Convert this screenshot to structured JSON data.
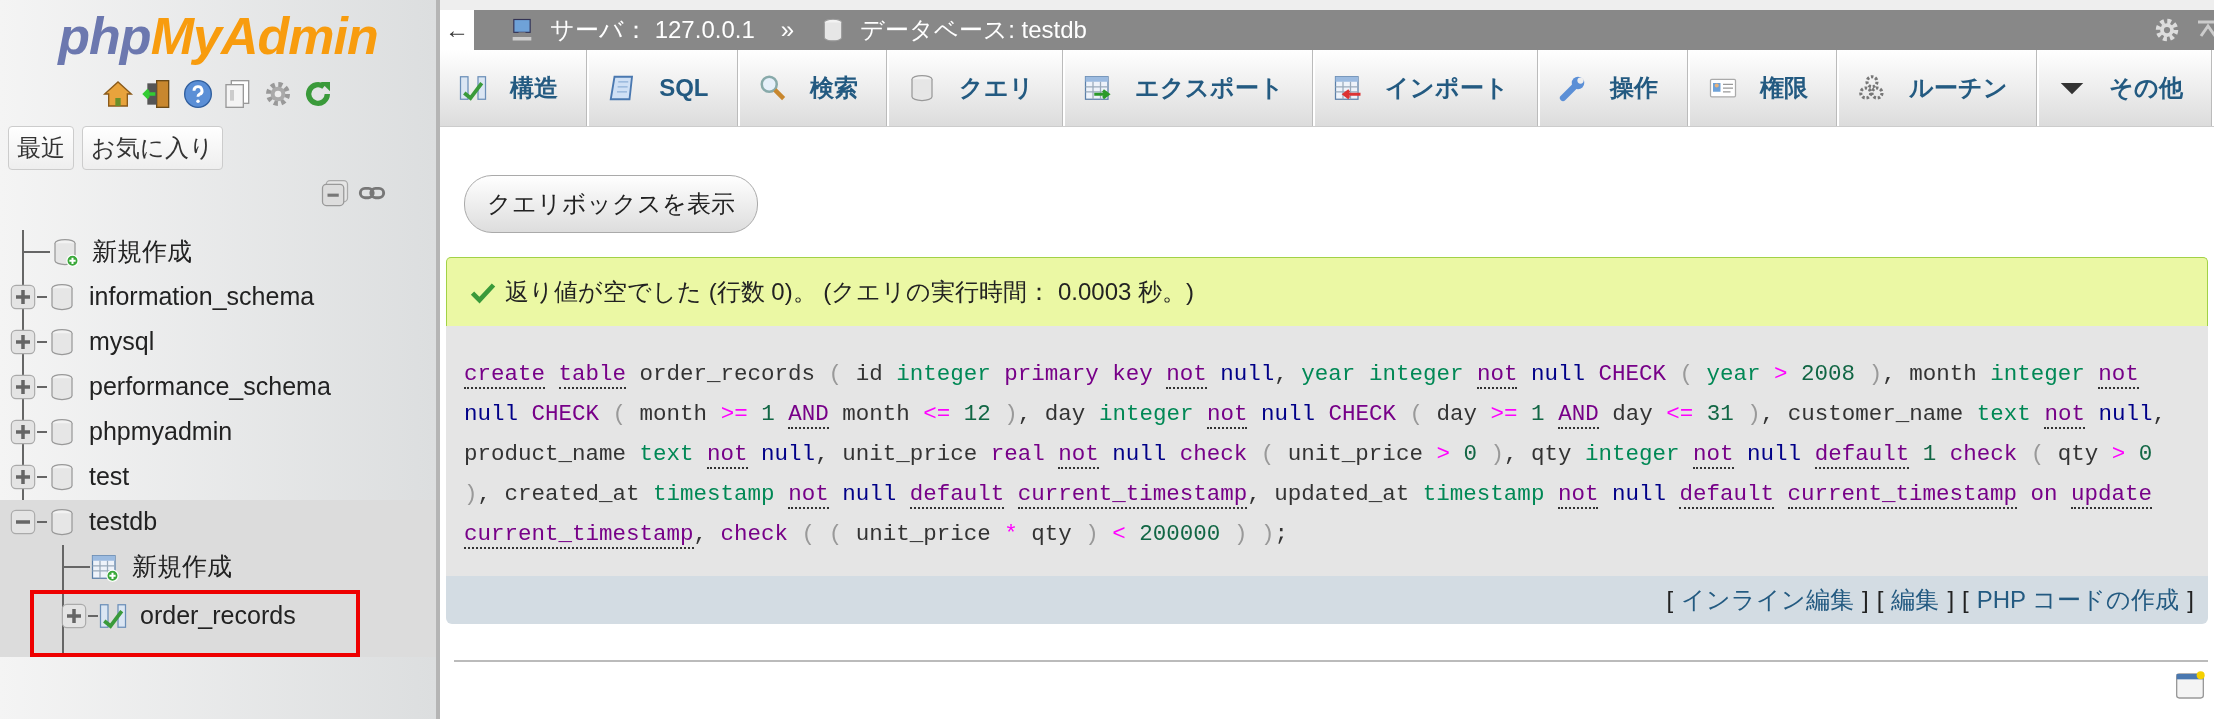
{
  "sidebar": {
    "logo": [
      {
        "text": "php",
        "color": "#6c78af"
      },
      {
        "text": "MyAdmin",
        "color": "#f89c0e"
      }
    ],
    "buttons": [
      "最近",
      "お気に入り"
    ],
    "tree": [
      {
        "label": "新規作成",
        "kind": "new",
        "selected": false
      },
      {
        "label": "information_schema",
        "kind": "database",
        "expanded": false,
        "selected": false
      },
      {
        "label": "mysql",
        "kind": "database",
        "expanded": false,
        "selected": false
      },
      {
        "label": "performance_schema",
        "kind": "database",
        "expanded": false,
        "selected": false
      },
      {
        "label": "phpmyadmin",
        "kind": "database",
        "expanded": false,
        "selected": false
      },
      {
        "label": "test",
        "kind": "database",
        "expanded": false,
        "selected": false
      },
      {
        "label": "testdb",
        "kind": "database",
        "expanded": true,
        "selected": true,
        "children": [
          {
            "label": "新規作成",
            "kind": "new-table",
            "selected": false
          },
          {
            "label": "order_records",
            "kind": "table",
            "expanded": false,
            "selected": false,
            "annotated": true
          }
        ]
      }
    ]
  },
  "breadcrumb": {
    "back": "←",
    "server": "サーバ： 127.0.0.1",
    "separator": "»",
    "database": "データベース: testdb"
  },
  "tabs": [
    {
      "label": "構造",
      "selected": false
    },
    {
      "label": "SQL",
      "selected": false
    },
    {
      "label": "検索",
      "selected": false
    },
    {
      "label": "クエリ",
      "selected": false
    },
    {
      "label": "エクスポート",
      "selected": false
    },
    {
      "label": "インポート",
      "selected": false
    },
    {
      "label": "操作",
      "selected": false
    },
    {
      "label": "権限",
      "selected": false
    },
    {
      "label": "ルーチン",
      "selected": false
    },
    {
      "label": "その他",
      "selected": false
    }
  ],
  "query_box_button": "クエリボックスを表示",
  "message": "返り値が空でした (行数 0)。 (クエリの実行時間： 0.0003 秒。)",
  "sql_tokens": [
    {
      "text": "create",
      "kind": "doc"
    },
    {
      "text": "table",
      "kind": "doc"
    },
    {
      "text": "order_records",
      "kind": "ident"
    },
    {
      "text": "(",
      "kind": "paren"
    },
    {
      "text": "id",
      "kind": "ident"
    },
    {
      "text": "integer",
      "kind": "type"
    },
    {
      "text": "primary",
      "kind": "keyword"
    },
    {
      "text": "key",
      "kind": "keyword"
    },
    {
      "text": "not",
      "kind": "doc"
    },
    {
      "text": "null",
      "kind": "null"
    },
    {
      "text": ",",
      "kind": "punct"
    },
    {
      "text": "year",
      "kind": "type"
    },
    {
      "text": "integer",
      "kind": "type"
    },
    {
      "text": "not",
      "kind": "doc"
    },
    {
      "text": "null",
      "kind": "null"
    },
    {
      "text": "CHECK",
      "kind": "keyword"
    },
    {
      "text": "(",
      "kind": "paren"
    },
    {
      "text": "year",
      "kind": "type"
    },
    {
      "text": ">",
      "kind": "operator"
    },
    {
      "text": "2008",
      "kind": "number"
    },
    {
      "text": ")",
      "kind": "paren"
    },
    {
      "text": ",",
      "kind": "punct"
    },
    {
      "text": "month",
      "kind": "ident"
    },
    {
      "text": "integer",
      "kind": "type"
    },
    {
      "text": "not",
      "kind": "doc"
    },
    {
      "text": "null",
      "kind": "null"
    },
    {
      "text": "CHECK",
      "kind": "keyword"
    },
    {
      "text": "(",
      "kind": "paren"
    },
    {
      "text": "month",
      "kind": "ident"
    },
    {
      "text": ">=",
      "kind": "operator"
    },
    {
      "text": "1",
      "kind": "number"
    },
    {
      "text": "AND",
      "kind": "doc"
    },
    {
      "text": "month",
      "kind": "ident"
    },
    {
      "text": "<=",
      "kind": "operator"
    },
    {
      "text": "12",
      "kind": "number"
    },
    {
      "text": ")",
      "kind": "paren"
    },
    {
      "text": ",",
      "kind": "punct"
    },
    {
      "text": "day",
      "kind": "ident"
    },
    {
      "text": "integer",
      "kind": "type"
    },
    {
      "text": "not",
      "kind": "doc"
    },
    {
      "text": "null",
      "kind": "null"
    },
    {
      "text": "CHECK",
      "kind": "keyword"
    },
    {
      "text": "(",
      "kind": "paren"
    },
    {
      "text": "day",
      "kind": "ident"
    },
    {
      "text": ">=",
      "kind": "operator"
    },
    {
      "text": "1",
      "kind": "number"
    },
    {
      "text": "AND",
      "kind": "doc"
    },
    {
      "text": "day",
      "kind": "ident"
    },
    {
      "text": "<=",
      "kind": "operator"
    },
    {
      "text": "31",
      "kind": "number"
    },
    {
      "text": ")",
      "kind": "paren"
    },
    {
      "text": ",",
      "kind": "punct"
    },
    {
      "text": "customer_name",
      "kind": "ident"
    },
    {
      "text": "text",
      "kind": "type"
    },
    {
      "text": "not",
      "kind": "doc"
    },
    {
      "text": "null",
      "kind": "null"
    },
    {
      "text": ",",
      "kind": "punct"
    },
    {
      "text": "product_name",
      "kind": "ident"
    },
    {
      "text": "text",
      "kind": "type"
    },
    {
      "text": "not",
      "kind": "doc"
    },
    {
      "text": "null",
      "kind": "null"
    },
    {
      "text": ",",
      "kind": "punct"
    },
    {
      "text": "unit_price",
      "kind": "ident"
    },
    {
      "text": "real",
      "kind": "keyword"
    },
    {
      "text": "not",
      "kind": "doc"
    },
    {
      "text": "null",
      "kind": "null"
    },
    {
      "text": "check",
      "kind": "keyword"
    },
    {
      "text": "(",
      "kind": "paren"
    },
    {
      "text": "unit_price",
      "kind": "ident"
    },
    {
      "text": ">",
      "kind": "operator"
    },
    {
      "text": "0",
      "kind": "number"
    },
    {
      "text": ")",
      "kind": "paren"
    },
    {
      "text": ",",
      "kind": "punct"
    },
    {
      "text": "qty",
      "kind": "ident"
    },
    {
      "text": "integer",
      "kind": "type"
    },
    {
      "text": "not",
      "kind": "doc"
    },
    {
      "text": "null",
      "kind": "null"
    },
    {
      "text": "default",
      "kind": "doc"
    },
    {
      "text": "1",
      "kind": "number"
    },
    {
      "text": "check",
      "kind": "keyword"
    },
    {
      "text": "(",
      "kind": "paren"
    },
    {
      "text": "qty",
      "kind": "ident"
    },
    {
      "text": ">",
      "kind": "operator"
    },
    {
      "text": "0",
      "kind": "number"
    },
    {
      "text": ")",
      "kind": "paren"
    },
    {
      "text": ",",
      "kind": "punct"
    },
    {
      "text": "created_at",
      "kind": "ident"
    },
    {
      "text": "timestamp",
      "kind": "type"
    },
    {
      "text": "not",
      "kind": "doc"
    },
    {
      "text": "null",
      "kind": "null"
    },
    {
      "text": "default",
      "kind": "doc"
    },
    {
      "text": "current_timestamp",
      "kind": "doc"
    },
    {
      "text": ",",
      "kind": "punct"
    },
    {
      "text": "updated_at",
      "kind": "ident"
    },
    {
      "text": "timestamp",
      "kind": "type"
    },
    {
      "text": "not",
      "kind": "doc"
    },
    {
      "text": "null",
      "kind": "null"
    },
    {
      "text": "default",
      "kind": "doc"
    },
    {
      "text": "current_timestamp",
      "kind": "doc"
    },
    {
      "text": "on",
      "kind": "keyword"
    },
    {
      "text": "update",
      "kind": "doc"
    },
    {
      "text": "current_timestamp",
      "kind": "doc"
    },
    {
      "text": ",",
      "kind": "punct"
    },
    {
      "text": "check",
      "kind": "keyword"
    },
    {
      "text": "(",
      "kind": "paren"
    },
    {
      "text": "(",
      "kind": "paren"
    },
    {
      "text": "unit_price",
      "kind": "ident"
    },
    {
      "text": "*",
      "kind": "operator"
    },
    {
      "text": "qty",
      "kind": "ident"
    },
    {
      "text": ")",
      "kind": "paren"
    },
    {
      "text": "<",
      "kind": "operator"
    },
    {
      "text": "200000",
      "kind": "number"
    },
    {
      "text": ")",
      "kind": "paren"
    },
    {
      "text": ")",
      "kind": "paren"
    },
    {
      "text": ";",
      "kind": "punct"
    }
  ],
  "actions": [
    {
      "kind": "bracket",
      "text": "["
    },
    {
      "kind": "link",
      "text": "インライン編集"
    },
    {
      "kind": "bracket",
      "text": "]"
    },
    {
      "kind": "bracket",
      "text": "["
    },
    {
      "kind": "link",
      "text": "編集"
    },
    {
      "kind": "bracket",
      "text": "]"
    },
    {
      "kind": "bracket",
      "text": "["
    },
    {
      "kind": "link",
      "text": "PHP コードの作成"
    },
    {
      "kind": "bracket",
      "text": "]"
    }
  ]
}
